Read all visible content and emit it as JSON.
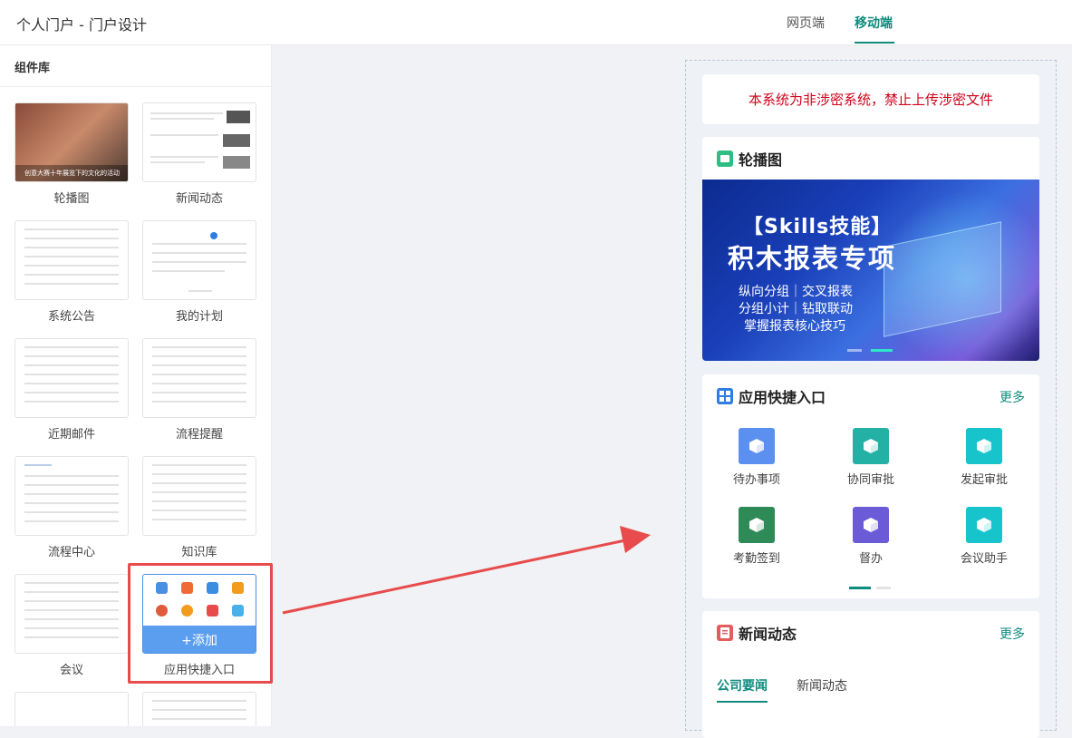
{
  "header": {
    "title": "个人门户 - 门户设计",
    "tabs": [
      {
        "label": "网页端"
      },
      {
        "label": "移动端"
      }
    ]
  },
  "sidebar": {
    "title": "组件库",
    "components": [
      {
        "label": "轮播图"
      },
      {
        "label": "新闻动态"
      },
      {
        "label": "系统公告"
      },
      {
        "label": "我的计划"
      },
      {
        "label": "近期邮件"
      },
      {
        "label": "流程提醒"
      },
      {
        "label": "流程中心"
      },
      {
        "label": "知识库"
      },
      {
        "label": "会议"
      },
      {
        "label": "应用快捷入口"
      }
    ],
    "carousel_caption": "创意大赛十年展览下的文化的活动",
    "add_label": "+添加"
  },
  "preview": {
    "notice": "本系统为非涉密系统，禁止上传涉密文件",
    "carousel": {
      "title": "轮播图",
      "banner": {
        "tag": "【Skills技能】",
        "headline": "积木报表专项",
        "lines": [
          "纵向分组｜交叉报表",
          "分组小计｜钻取联动",
          "掌握报表核心技巧"
        ]
      }
    },
    "apps": {
      "title": "应用快捷入口",
      "more": "更多",
      "items": [
        {
          "label": "待办事项",
          "color": "#5b8ff0"
        },
        {
          "label": "协同审批",
          "color": "#23b0a5"
        },
        {
          "label": "发起审批",
          "color": "#17c4cc"
        },
        {
          "label": "考勤签到",
          "color": "#2e8a57"
        },
        {
          "label": "督办",
          "color": "#6b5bd6"
        },
        {
          "label": "会议助手",
          "color": "#17c4cc"
        }
      ]
    },
    "news": {
      "title": "新闻动态",
      "more": "更多",
      "tabs": [
        {
          "label": "公司要闻"
        },
        {
          "label": "新闻动态"
        }
      ]
    }
  },
  "colors": {
    "accent": "#0f8b7d",
    "highlight": "#e84b4b",
    "notice": "#d0021b"
  }
}
